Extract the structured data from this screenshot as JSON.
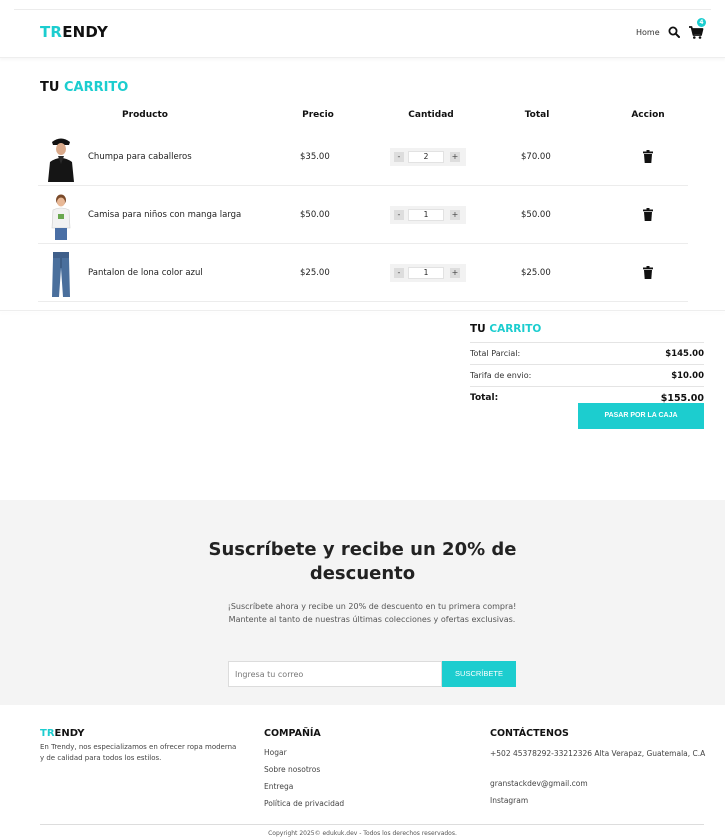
{
  "brand": {
    "logo_prefix": "TR",
    "logo_rest": "ENDY",
    "accent_color": "#1ccdcf"
  },
  "nav": {
    "home_label": "Home",
    "search_icon": "search-icon",
    "cart_icon": "cart-icon",
    "cart_count": "4"
  },
  "cart": {
    "title_part1": "TU",
    "title_part2": "CARRITO",
    "headers": {
      "product": "Producto",
      "price": "Precio",
      "quantity": "Cantidad",
      "total": "Total",
      "action": "Accion"
    },
    "items": [
      {
        "name": "Chumpa para caballeros",
        "price": "$35.00",
        "qty": "2",
        "total": "$70.00",
        "image": "man-black-jacket"
      },
      {
        "name": "Camisa para niños con manga larga",
        "price": "$50.00",
        "qty": "1",
        "total": "$50.00",
        "image": "kid-white-shirt"
      },
      {
        "name": "Pantalon de lona color azul",
        "price": "$25.00",
        "qty": "1",
        "total": "$25.00",
        "image": "blue-jeans"
      }
    ],
    "qty_minus": "-",
    "qty_plus": "+"
  },
  "summary": {
    "title_part1": "TU",
    "title_part2": "CARRITO",
    "subtotal_label": "Total Parcial:",
    "subtotal_value": "$145.00",
    "shipping_label": "Tarifa de envio:",
    "shipping_value": "$10.00",
    "total_label": "Total:",
    "total_value": "$155.00",
    "checkout_label": "PASAR POR LA CAJA"
  },
  "subscribe": {
    "title_line1": "Suscríbete y recibe un 20% de",
    "title_line2": "descuento",
    "text": "¡Suscríbete ahora y recibe un 20% de descuento en tu primera compra! Mantente al tanto de nuestras últimas colecciones y ofertas exclusivas.",
    "placeholder": "Ingresa tu correo",
    "button_label": "SUSCRÍBETE"
  },
  "footer": {
    "logo_prefix": "TR",
    "logo_rest": "ENDY",
    "about": "En Trendy, nos especializamos en ofrecer ropa moderna y de calidad para todos los estilos.",
    "company_title": "COMPAÑÍA",
    "company_links": [
      "Hogar",
      "Sobre nosotros",
      "Entrega",
      "Política de privacidad"
    ],
    "contact_title": "CONTÁCTENOS",
    "contact_address": "+502 45378292-33212326 Alta Verapaz, Guatemala, C.A",
    "contact_email": "granstackdev@gmail.com",
    "contact_social": "Instagram",
    "copyright": "Copyright 2025© edukuk.dev - Todos los derechos reservados."
  }
}
